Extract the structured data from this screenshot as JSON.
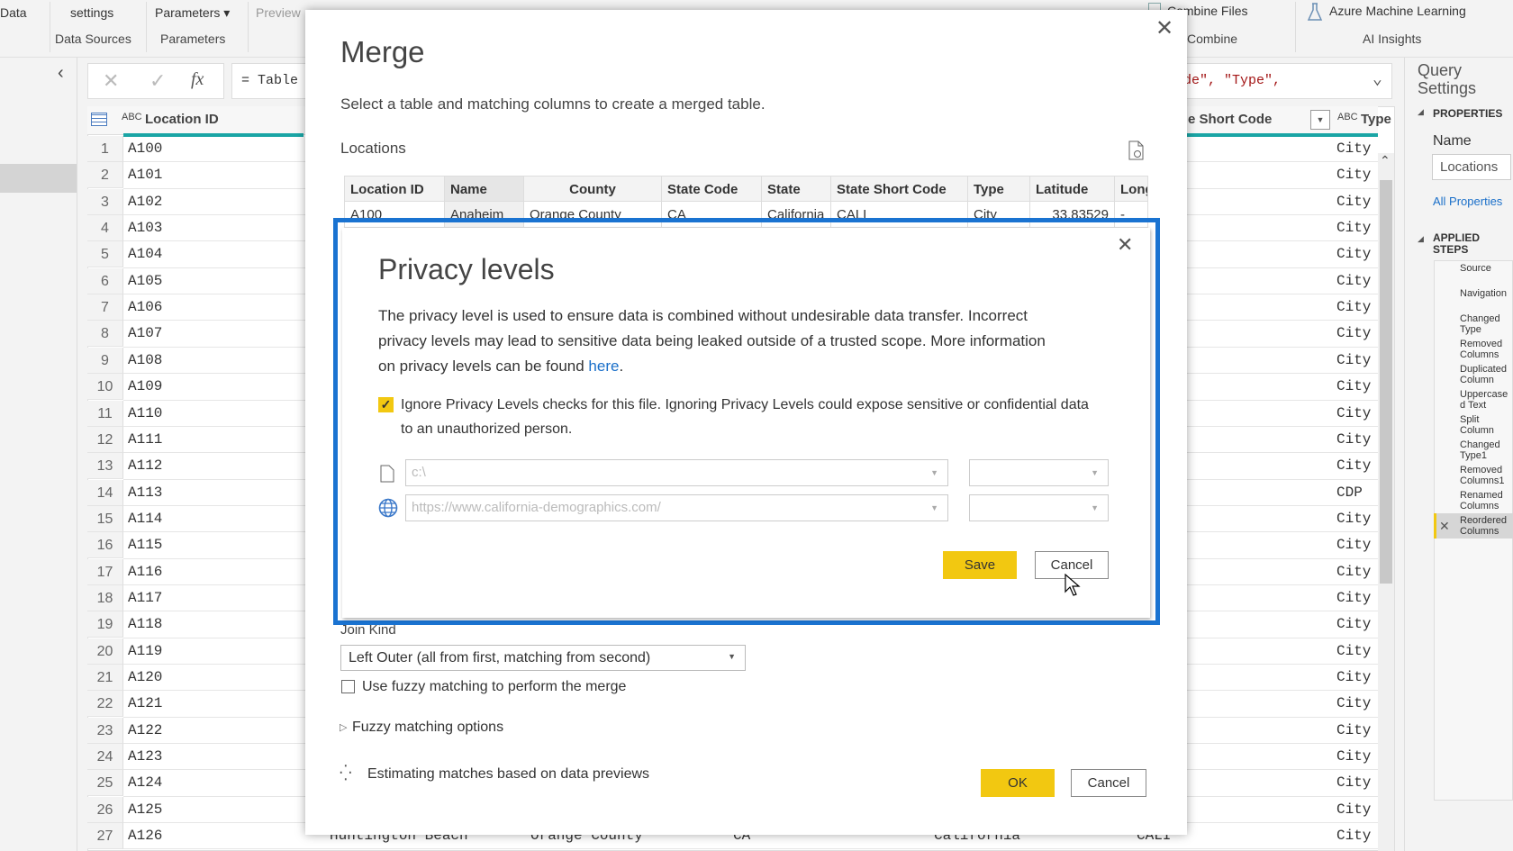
{
  "ribbon": {
    "items": [
      "Data",
      "settings",
      "Parameters ▾",
      "Preview",
      "Combine Files",
      "Azure Machine Learning"
    ],
    "groups": [
      "Data Sources",
      "Parameters",
      "Combine",
      "AI Insights"
    ]
  },
  "formula_bar": {
    "cancel": "✕",
    "confirm": "✓",
    "fx": "fx",
    "left_text": "= Table",
    "right_text": "de\", \"Type\","
  },
  "grid": {
    "headers": {
      "location_id": "Location ID",
      "short_code": "e Short Code",
      "type": "Type",
      "type_prefix": "ABC"
    },
    "rows": [
      {
        "n": "1",
        "id": "A100",
        "type": "City"
      },
      {
        "n": "2",
        "id": "A101",
        "type": "City"
      },
      {
        "n": "3",
        "id": "A102",
        "type": "City"
      },
      {
        "n": "4",
        "id": "A103",
        "type": "City"
      },
      {
        "n": "5",
        "id": "A104",
        "type": "City"
      },
      {
        "n": "6",
        "id": "A105",
        "type": "City"
      },
      {
        "n": "7",
        "id": "A106",
        "type": "City"
      },
      {
        "n": "8",
        "id": "A107",
        "type": "City"
      },
      {
        "n": "9",
        "id": "A108",
        "type": "City"
      },
      {
        "n": "10",
        "id": "A109",
        "type": "City"
      },
      {
        "n": "11",
        "id": "A110",
        "type": "City"
      },
      {
        "n": "12",
        "id": "A111",
        "type": "City"
      },
      {
        "n": "13",
        "id": "A112",
        "type": "City"
      },
      {
        "n": "14",
        "id": "A113",
        "type": "CDP"
      },
      {
        "n": "15",
        "id": "A114",
        "type": "City"
      },
      {
        "n": "16",
        "id": "A115",
        "type": "City"
      },
      {
        "n": "17",
        "id": "A116",
        "type": "City"
      },
      {
        "n": "18",
        "id": "A117",
        "type": "City"
      },
      {
        "n": "19",
        "id": "A118",
        "type": "City"
      },
      {
        "n": "20",
        "id": "A119",
        "type": "City"
      },
      {
        "n": "21",
        "id": "A120",
        "type": "City"
      },
      {
        "n": "22",
        "id": "A121",
        "type": "City"
      },
      {
        "n": "23",
        "id": "A122",
        "type": "City"
      },
      {
        "n": "24",
        "id": "A123",
        "type": "City"
      },
      {
        "n": "25",
        "id": "A124",
        "type": "City"
      },
      {
        "n": "26",
        "id": "A125",
        "type": "City"
      },
      {
        "n": "27",
        "id": "A126",
        "type": "City"
      }
    ],
    "row27_extra": [
      "Huntington Beach",
      "Orange County",
      "CA",
      "California",
      "CALI"
    ]
  },
  "query_settings": {
    "title": "Query Settings",
    "properties": "PROPERTIES",
    "name_label": "Name",
    "name_value": "Locations",
    "all_properties": "All Properties",
    "applied_steps": "APPLIED STEPS",
    "steps": [
      "Source",
      "Navigation",
      "Changed Type",
      "Removed Columns",
      "Duplicated Column",
      "Uppercased Text",
      "Split Column",
      "Changed Type1",
      "Removed Columns1",
      "Renamed Columns",
      "Reordered Columns"
    ]
  },
  "merge": {
    "title": "Merge",
    "subtitle": "Select a table and matching columns to create a merged table.",
    "table_name": "Locations",
    "columns": [
      "Location ID",
      "Name",
      "County",
      "State Code",
      "State",
      "State Short Code",
      "Type",
      "Latitude",
      "Long"
    ],
    "first_row": [
      "A100",
      "Anaheim",
      "Orange County",
      "CA",
      "California",
      "CALI",
      "City",
      "33.83529",
      "-"
    ],
    "join_kind_label": "Join Kind",
    "join_kind_value": "Left Outer (all from first, matching from second)",
    "fuzzy_checkbox": "Use fuzzy matching to perform the merge",
    "fuzzy_checked": false,
    "fuzzy_options": "Fuzzy matching options",
    "status": "Estimating matches based on data previews",
    "ok": "OK",
    "cancel": "Cancel"
  },
  "privacy": {
    "title": "Privacy levels",
    "line1": "The privacy level is used to ensure data is combined without undesirable data transfer. Incorrect",
    "line2": "privacy levels may lead to sensitive data being leaked outside of a trusted scope. More information",
    "line3": "on privacy levels can be found ",
    "link": "here",
    "line3_end": ".",
    "ignore_checked": true,
    "ignore_line1": "Ignore Privacy Levels checks for this file. Ignoring Privacy Levels could expose sensitive or confidential data",
    "ignore_line2": "to an unauthorized person.",
    "sources": [
      {
        "icon": "file-icon",
        "value": "c:\\",
        "level": ""
      },
      {
        "icon": "globe-icon",
        "value": "https://www.california-demographics.com/",
        "level": ""
      }
    ],
    "save": "Save",
    "cancel": "Cancel"
  },
  "colors": {
    "accent": "#f2c811",
    "highlight_border": "#1a73d1",
    "teal": "#1aa5a5",
    "link": "#1a6fc9"
  }
}
